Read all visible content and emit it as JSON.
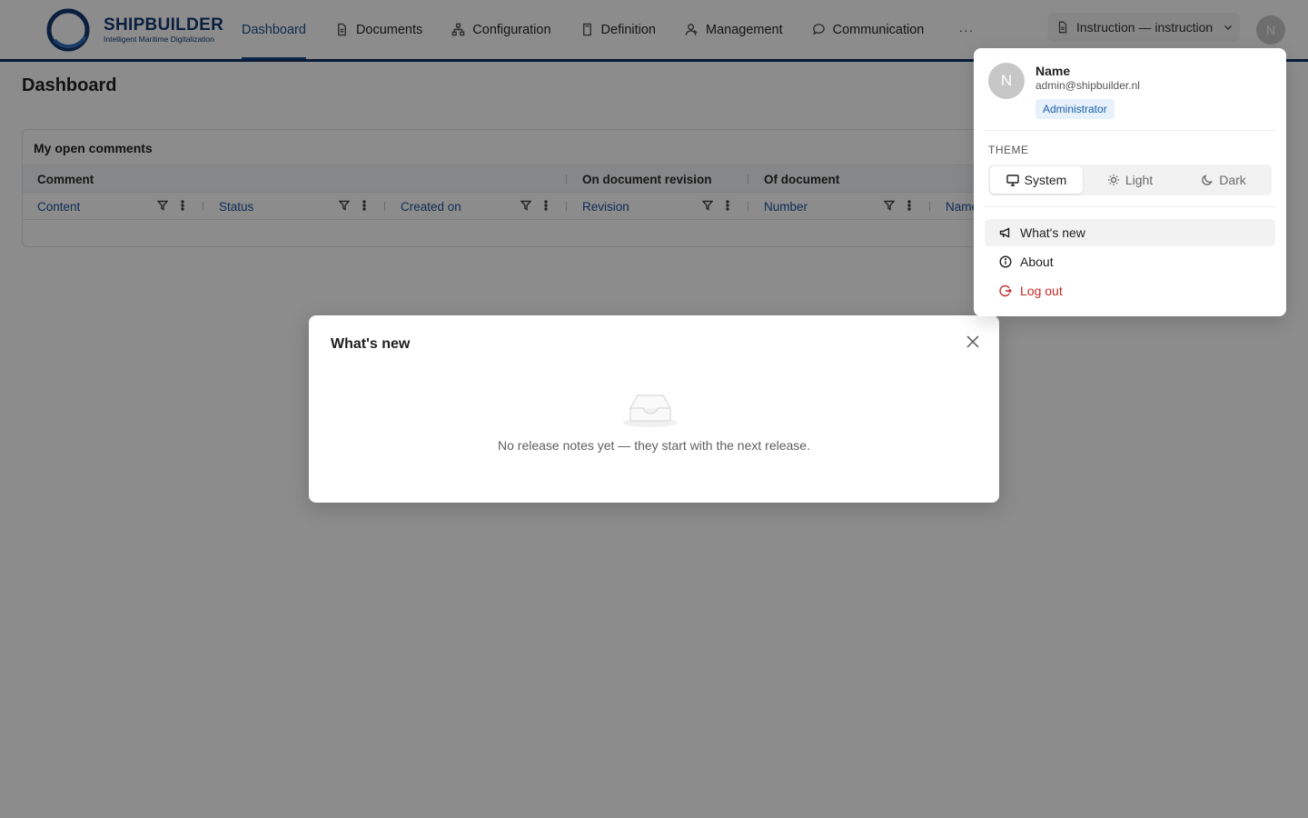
{
  "brand": {
    "name": "SHIPBUILDER",
    "tagline": "Intelligent Maritime Digitalization"
  },
  "nav": {
    "items": [
      {
        "label": "Dashboard",
        "icon": "none",
        "active": true
      },
      {
        "label": "Documents",
        "icon": "document-icon"
      },
      {
        "label": "Configuration",
        "icon": "hierarchy-icon"
      },
      {
        "label": "Definition",
        "icon": "file-icon"
      },
      {
        "label": "Management",
        "icon": "users-icon"
      },
      {
        "label": "Communication",
        "icon": "chat-icon"
      }
    ],
    "more": "···"
  },
  "context": {
    "label": "Instruction — instruction"
  },
  "user": {
    "initial": "N",
    "name": "Name",
    "email": "admin@shipbuilder.nl",
    "role": "Administrator"
  },
  "page": {
    "title": "Dashboard"
  },
  "card": {
    "title": "My open comments",
    "groups": [
      "Comment",
      "On document revision",
      "Of document"
    ],
    "columns": [
      "Content",
      "Status",
      "Created on",
      "Revision",
      "Number",
      "Name"
    ]
  },
  "dialog": {
    "title": "What's new",
    "empty_text": "No release notes yet — they start with the next release."
  },
  "popover": {
    "theme_label": "THEME",
    "theme_options": [
      "System",
      "Light",
      "Dark"
    ],
    "theme_selected": "System",
    "menu": [
      "What's new",
      "About",
      "Log out"
    ]
  },
  "colors": {
    "brand": "#133a72",
    "accent": "#1a4f8b",
    "danger": "#c62828",
    "role_badge_bg": "#e6f1fb"
  }
}
